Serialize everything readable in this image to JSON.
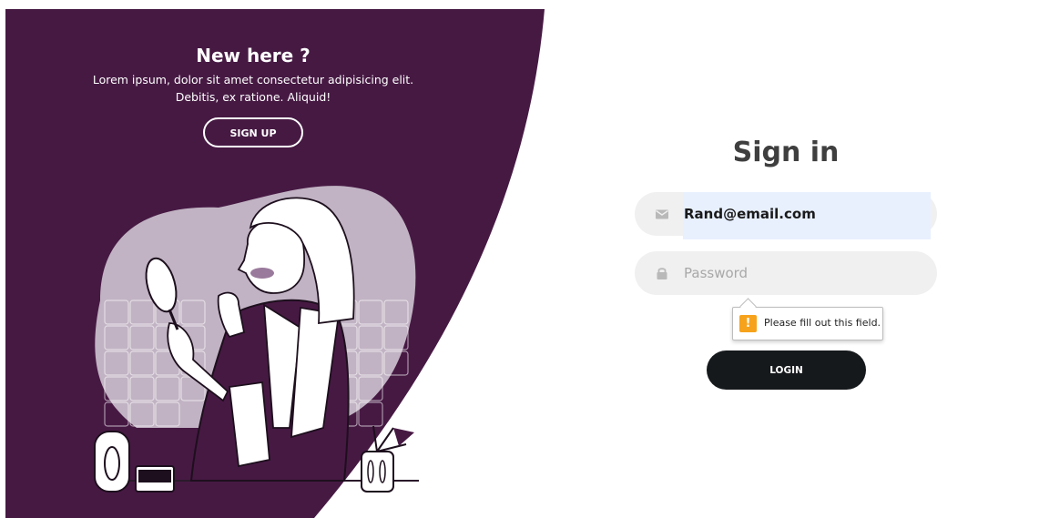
{
  "panel": {
    "title": "New here ?",
    "text_line1": "Lorem ipsum, dolor sit amet consectetur adipisicing elit.",
    "text_line2": "Debitis, ex ratione. Aliquid!",
    "signup_label": "SIGN UP",
    "illustration": "woman-with-mirror-illustration"
  },
  "form": {
    "title": "Sign in",
    "email": {
      "value": "Rand@email.com",
      "icon": "envelope-icon"
    },
    "password": {
      "placeholder": "Password",
      "icon": "lock-icon"
    },
    "validation_tooltip": {
      "icon": "warning-icon",
      "text": "Please fill out this field."
    },
    "login_label": "LOGIN"
  },
  "colors": {
    "panel_bg": "#461943",
    "blob": "#c1b3c3",
    "field_bg": "#f0f0f0",
    "autofill_bg": "#e8f0fe",
    "login_bg": "#16191c",
    "warning": "#f7a21b"
  }
}
